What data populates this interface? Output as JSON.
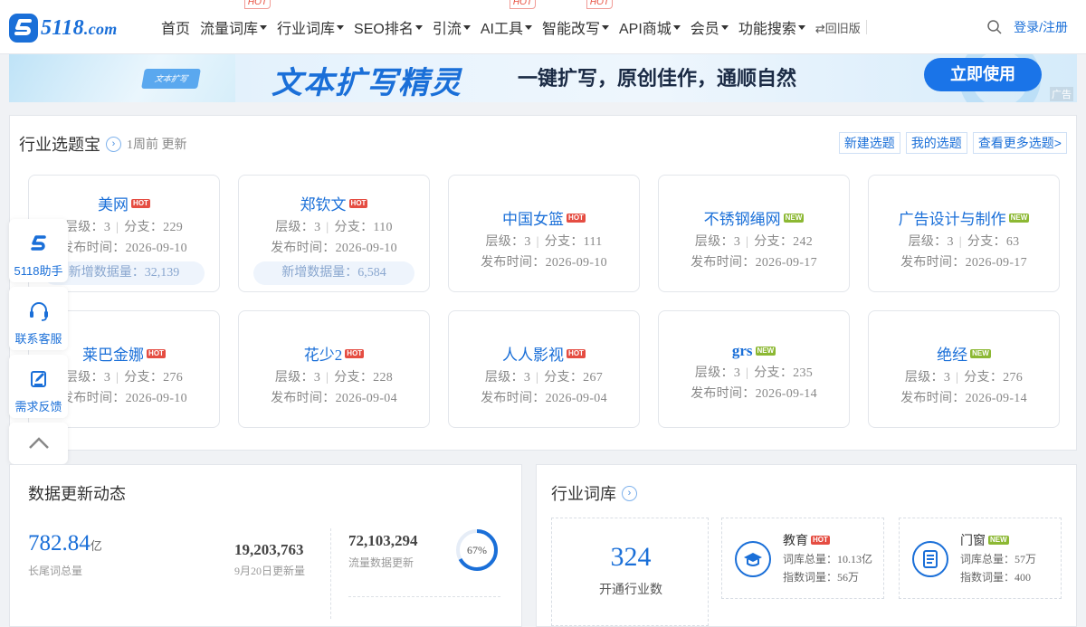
{
  "header": {
    "logo_text": "5118",
    "logo_suffix": ".com",
    "nav": [
      {
        "label": "首页",
        "caret": false,
        "hot": ""
      },
      {
        "label": "流量词库",
        "caret": true,
        "hot": "HOT"
      },
      {
        "label": "行业词库",
        "caret": true,
        "hot": ""
      },
      {
        "label": "SEO排名",
        "caret": true,
        "hot": ""
      },
      {
        "label": "引流",
        "caret": true,
        "hot": ""
      },
      {
        "label": "AI工具",
        "caret": true,
        "hot": "HOT"
      },
      {
        "label": "智能改写",
        "caret": true,
        "hot": "HOT"
      },
      {
        "label": "API商城",
        "caret": true,
        "hot": ""
      },
      {
        "label": "会员",
        "caret": true,
        "hot": ""
      },
      {
        "label": "功能搜索",
        "caret": true,
        "hot": ""
      }
    ],
    "old_version": "⇄回旧版",
    "login": "登录/注册"
  },
  "banner": {
    "card_text": "文本扩写",
    "title": "文本扩写精灵",
    "slogan": "一键扩写，原创佳作，通顺自然",
    "button": "立即使用",
    "ad_label": "广告"
  },
  "topics": {
    "title": "行业选题宝",
    "updated": "1周前 更新",
    "links": [
      "新建选题",
      "我的选题",
      "查看更多选题>"
    ],
    "meta_level": "层级：",
    "meta_branch": "分支：",
    "meta_date": "发布时间：",
    "meta_new": "新增数据量：",
    "cards": [
      {
        "name": "美网",
        "tag": "HOT",
        "level": "3",
        "branch": "229",
        "date": "2026-09-10",
        "new_data": "32,139"
      },
      {
        "name": "郑钦文",
        "tag": "HOT",
        "level": "3",
        "branch": "110",
        "date": "2026-09-10",
        "new_data": "6,584"
      },
      {
        "name": "中国女篮",
        "tag": "HOT",
        "level": "3",
        "branch": "111",
        "date": "2026-09-10",
        "new_data": ""
      },
      {
        "name": "不锈钢绳网",
        "tag": "NEW",
        "level": "3",
        "branch": "242",
        "date": "2026-09-17",
        "new_data": ""
      },
      {
        "name": "广告设计与制作",
        "tag": "NEW",
        "level": "3",
        "branch": "63",
        "date": "2026-09-17",
        "new_data": ""
      },
      {
        "name": "莱巴金娜",
        "tag": "HOT",
        "level": "3",
        "branch": "276",
        "date": "2026-09-10",
        "new_data": ""
      },
      {
        "name": "花少2",
        "tag": "HOT",
        "level": "3",
        "branch": "228",
        "date": "2026-09-04",
        "new_data": ""
      },
      {
        "name": "人人影视",
        "tag": "HOT",
        "level": "3",
        "branch": "267",
        "date": "2026-09-04",
        "new_data": ""
      },
      {
        "name": "grs",
        "tag": "NEW",
        "level": "3",
        "branch": "235",
        "date": "2026-09-14",
        "new_data": ""
      },
      {
        "name": "绝经",
        "tag": "NEW",
        "level": "3",
        "branch": "276",
        "date": "2026-09-14",
        "new_data": ""
      }
    ]
  },
  "float_bar": {
    "assistant": "5118助手",
    "service": "联系客服",
    "feedback": "需求反馈"
  },
  "data_dynamics": {
    "title": "数据更新动态",
    "total_value": "782.84",
    "total_unit": "亿",
    "total_caption": "长尾词总量",
    "daily_value": "19,203,763",
    "daily_caption": "9月20日更新量",
    "traffic_value": "72,103,294",
    "traffic_caption": "流量数据更新",
    "gauge_text": "67%",
    "gauge_percent": 67
  },
  "industry_lib": {
    "title": "行业词库",
    "count": "324",
    "count_caption": "开通行业数",
    "items": [
      {
        "name": "教育",
        "tag": "HOT",
        "total": "词库总量：10.13亿",
        "index": "指数词量：56万"
      },
      {
        "name": "门窗",
        "tag": "NEW",
        "total": "词库总量：57万",
        "index": "指数词量：400"
      }
    ]
  },
  "colors": {
    "brand": "#1a6fd8",
    "hot": "#e54d42",
    "new": "#8cb833"
  }
}
